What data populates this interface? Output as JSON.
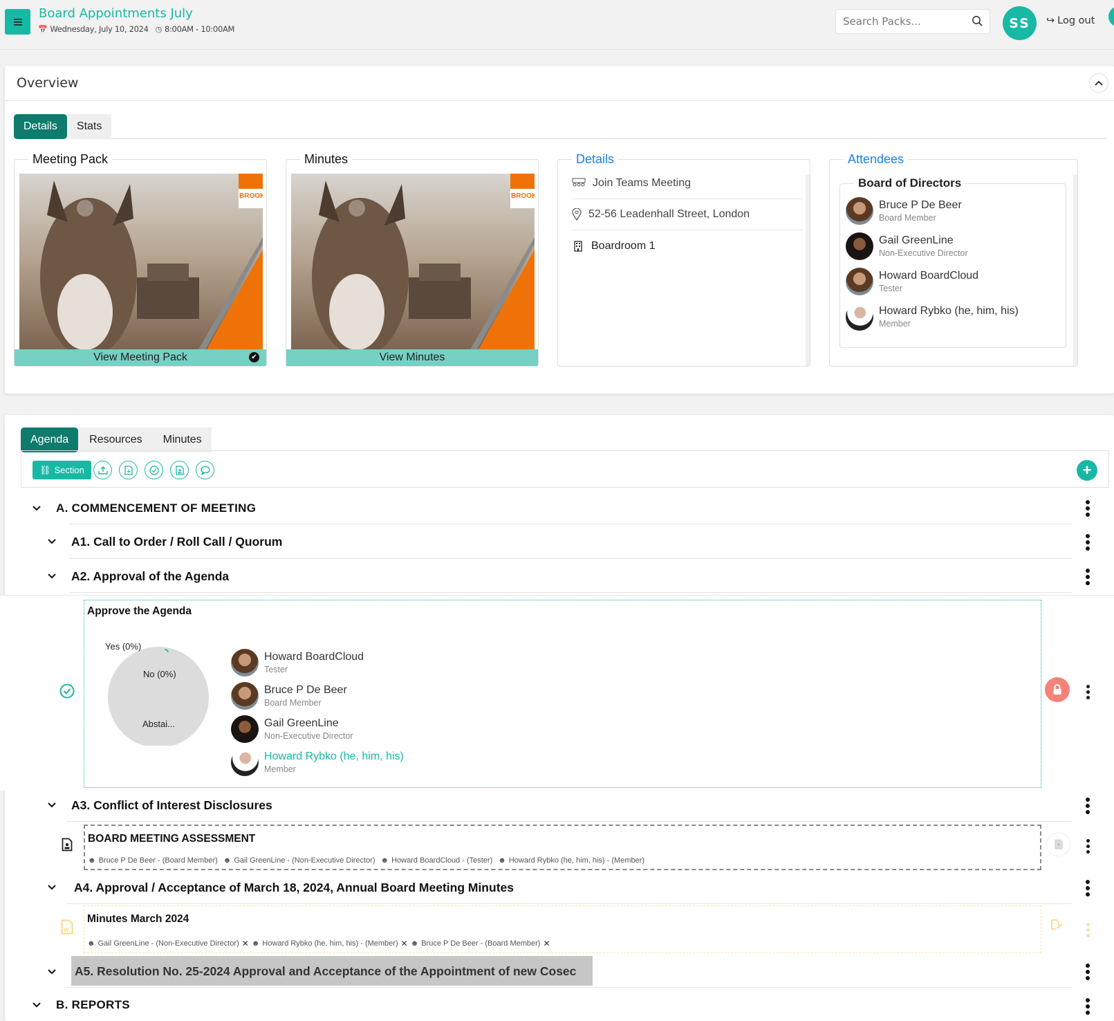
{
  "header": {
    "title": "Board Appointments July",
    "date": "Wednesday, July 10, 2024",
    "time": "8:00AM - 10:00AM",
    "search_placeholder": "Search Packs...",
    "user_initials": "SS",
    "logout_label": "Log out"
  },
  "overview": {
    "title": "Overview",
    "tabs": [
      {
        "label": "Details",
        "active": true
      },
      {
        "label": "Stats",
        "active": false
      }
    ],
    "meeting_pack": {
      "legend": "Meeting Pack",
      "button": "View Meeting Pack",
      "brand_text": "BROOKE",
      "checked": true
    },
    "minutes": {
      "legend": "Minutes",
      "button": "View Minutes",
      "brand_text": "BROOKE"
    },
    "details": {
      "legend": "Details",
      "items": [
        {
          "icon": "teams-meeting-icon",
          "text": "Join Teams Meeting"
        },
        {
          "icon": "location-pin-icon",
          "text": "52-56 Leadenhall Street, London"
        },
        {
          "icon": "building-icon",
          "text": "Boardroom 1"
        }
      ]
    },
    "attendees": {
      "legend": "Attendees",
      "group": "Board of Directors",
      "people": [
        {
          "name": "Bruce P De Beer",
          "role": "Board Member"
        },
        {
          "name": "Gail GreenLine",
          "role": "Non-Executive Director"
        },
        {
          "name": "Howard BoardCloud",
          "role": "Tester"
        },
        {
          "name": "Howard Rybko (he, him, his)",
          "role": "Member"
        }
      ]
    }
  },
  "agenda": {
    "tabs": [
      {
        "label": "Agenda",
        "active": true
      },
      {
        "label": "Resources",
        "active": false
      },
      {
        "label": "Minutes",
        "active": false
      }
    ],
    "toolbar": {
      "section_label": "Section",
      "tools": [
        "upload-icon",
        "add-document-icon",
        "check-circle-icon",
        "user-document-icon",
        "comment-icon"
      ]
    },
    "sections": [
      {
        "title": "A. COMMENCEMENT OF MEETING"
      },
      {
        "title": "A1. Call to Order / Roll Call / Quorum"
      },
      {
        "title": "A2. Approval of the Agenda"
      },
      {
        "title": "A3. Conflict of Interest Disclosures"
      },
      {
        "title": "A4. Approval / Acceptance of March 18, 2024, Annual Board Meeting Minutes"
      },
      {
        "title": "A5. Resolution No. 25-2024 Approval and Acceptance of the Appointment of new Cosec"
      },
      {
        "title": "B. REPORTS"
      }
    ],
    "vote": {
      "title": "Approve the Agenda",
      "chart_labels": {
        "yes": "Yes (0%)",
        "no": "No (0%)",
        "abstain": "Abstai..."
      },
      "voters": [
        {
          "name": "Howard BoardCloud",
          "role": "Tester",
          "highlight": false
        },
        {
          "name": "Bruce P De Beer",
          "role": "Board Member",
          "highlight": false
        },
        {
          "name": "Gail GreenLine",
          "role": "Non-Executive Director",
          "highlight": false
        },
        {
          "name": "Howard Rybko (he, him, his)",
          "role": "Member",
          "highlight": true
        }
      ]
    },
    "assessment": {
      "title": "BOARD MEETING ASSESSMENT",
      "assignees": [
        "Bruce P De Beer - (Board Member)",
        "Gail GreenLine - (Non-Executive Director)",
        "Howard BoardCloud - (Tester)",
        "Howard Rybko (he, him, his) - (Member)"
      ]
    },
    "minutes_doc": {
      "title": "Minutes March 2024",
      "assignees": [
        "Gail GreenLine - (Non-Executive Director)",
        "Howard Rybko (he, him, his) - (Member)",
        "Bruce P De Beer - (Board Member)"
      ]
    }
  },
  "colors": {
    "accent": "#17b9a5",
    "tab_active": "#0e7b6d",
    "view_bar": "#76d0c4",
    "link_blue": "#1a82e2",
    "lock": "#f5827a",
    "orange": "#ef7209"
  }
}
